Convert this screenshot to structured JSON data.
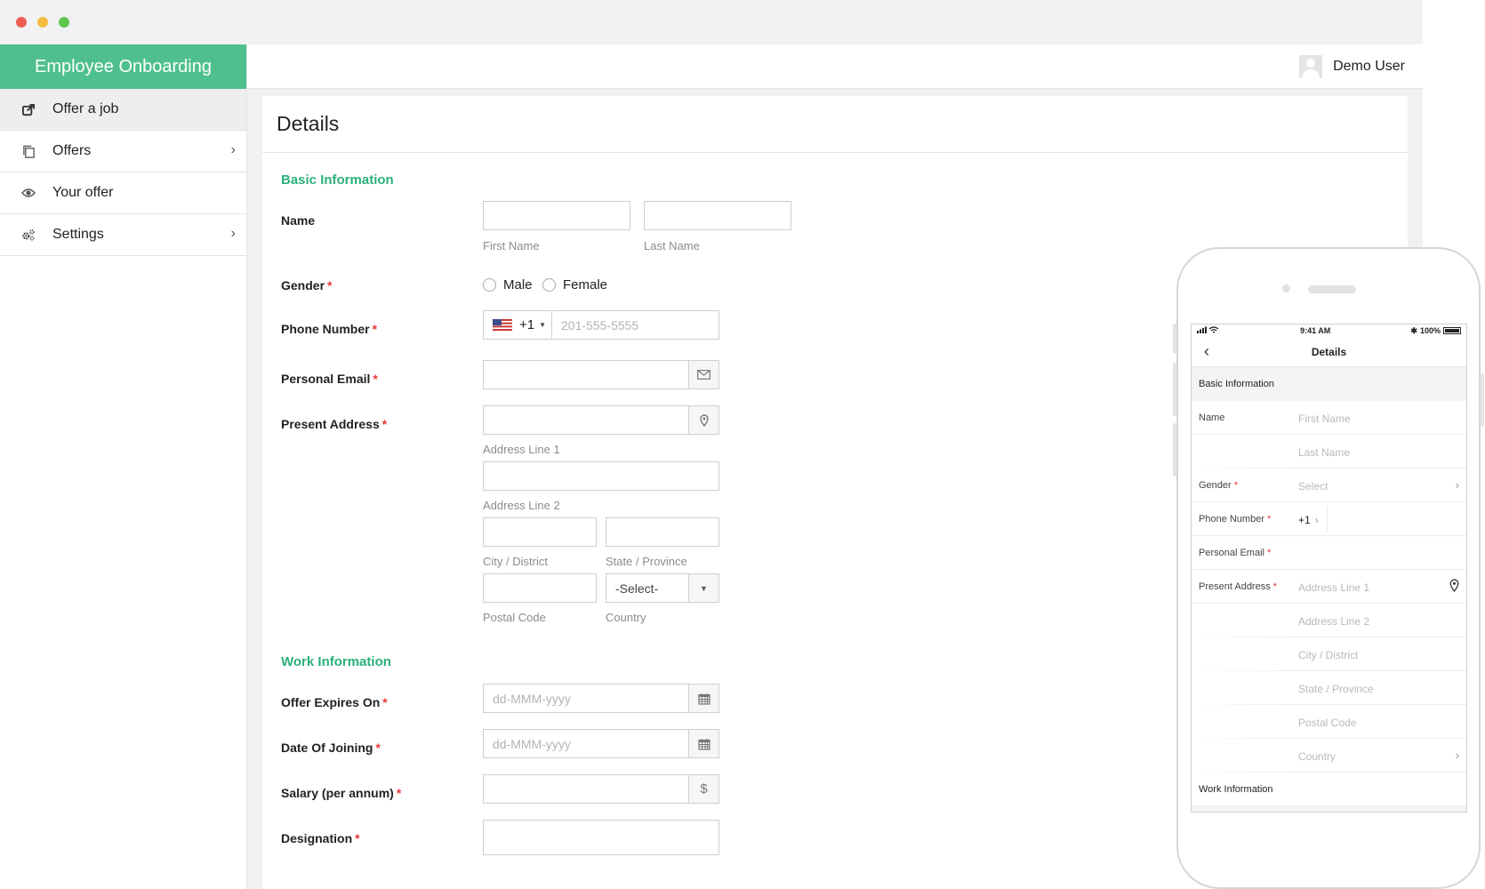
{
  "app": {
    "title": "Employee Onboarding",
    "user": "Demo User"
  },
  "sidebar": {
    "items": [
      {
        "label": "Offer a job",
        "icon": "share-icon",
        "has_chevron": false
      },
      {
        "label": "Offers",
        "icon": "copy-icon",
        "has_chevron": true
      },
      {
        "label": "Your offer",
        "icon": "eye-icon",
        "has_chevron": false
      },
      {
        "label": "Settings",
        "icon": "gears-icon",
        "has_chevron": true
      }
    ]
  },
  "main": {
    "title": "Details",
    "sections": {
      "basic": "Basic Information",
      "work": "Work Information"
    },
    "labels": {
      "name": "Name",
      "gender": "Gender",
      "phone": "Phone Number",
      "email": "Personal Email",
      "address": "Present Address",
      "offer_expires": "Offer Expires On",
      "joining": "Date Of Joining",
      "salary": "Salary (per annum)",
      "designation": "Designation"
    },
    "required_mark": "*",
    "hints": {
      "first_name": "First Name",
      "last_name": "Last Name",
      "address1": "Address Line 1",
      "address2": "Address Line 2",
      "city": "City / District",
      "state": "State / Province",
      "postal": "Postal Code",
      "country": "Country"
    },
    "gender_options": [
      "Male",
      "Female"
    ],
    "phone_code": "+1",
    "phone_placeholder": "201-555-5555",
    "country_select": "-Select-",
    "date_placeholder": "dd-MMM-yyyy",
    "currency_symbol": "$"
  },
  "mobile": {
    "status": {
      "time": "9:41 AM",
      "battery": "100%"
    },
    "title": "Details",
    "section_basic": "Basic Information",
    "section_work": "Work Information",
    "labels": {
      "name": "Name",
      "gender": "Gender",
      "phone": "Phone Number",
      "email": "Personal Email",
      "address": "Present Address"
    },
    "placeholders": {
      "first_name": "First Name",
      "last_name": "Last Name",
      "gender": "Select",
      "phone_code": "+1",
      "address1": "Address Line 1",
      "address2": "Address Line 2",
      "city": "City / District",
      "state": "State / Province",
      "postal": "Postal Code",
      "country": "Country"
    }
  },
  "colors": {
    "brand": "#4fc08d",
    "section_heading": "#2ab07a",
    "required": "#e53935"
  }
}
